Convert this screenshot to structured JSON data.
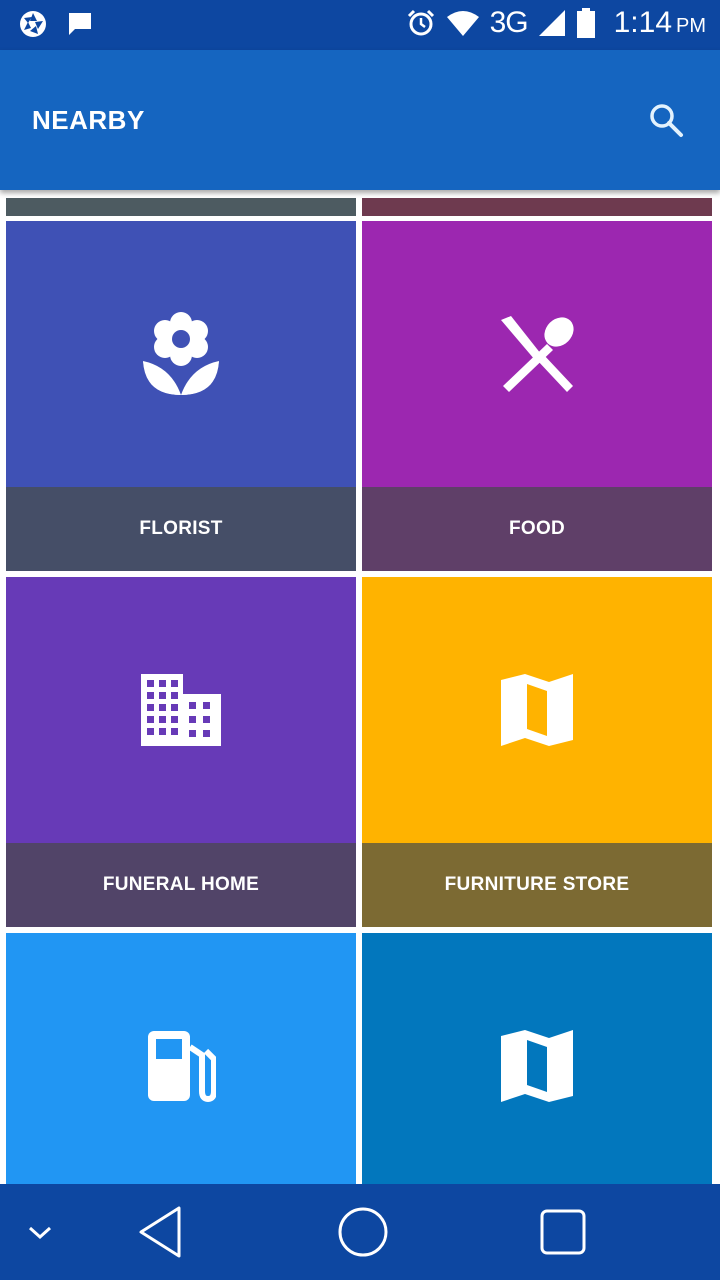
{
  "status_bar": {
    "left_icons": [
      "aperture-icon",
      "message-icon"
    ],
    "right_icons": [
      "alarm-icon",
      "wifi-icon",
      "signal-icon",
      "battery-icon"
    ],
    "network": "3G",
    "time": "1:14",
    "ampm": "PM"
  },
  "appbar": {
    "title": "NEARBY",
    "search_icon": "search-icon",
    "color": "#1565c0"
  },
  "tiles": [
    {
      "label": "FLORIST",
      "icon": "florist-icon",
      "color": "#3f51b5",
      "label_color": "#454e67"
    },
    {
      "label": "FOOD",
      "icon": "restaurant-icon",
      "color": "#9c27b0",
      "label_color": "#5f3f68"
    },
    {
      "label": "FUNERAL HOME",
      "icon": "building-icon",
      "color": "#673ab7",
      "label_color": "#514468"
    },
    {
      "label": "FURNITURE STORE",
      "icon": "map-icon",
      "color": "#ffb300",
      "label_color": "#7c6a33"
    },
    {
      "label": "",
      "icon": "gas-station-icon",
      "color": "#2196f3",
      "label_color": ""
    },
    {
      "label": "",
      "icon": "map-icon",
      "color": "#0277bd",
      "label_color": ""
    }
  ],
  "navbar": {
    "buttons": [
      "collapse-icon",
      "back-icon",
      "home-icon",
      "recents-icon"
    ],
    "color": "#0d47a1"
  }
}
